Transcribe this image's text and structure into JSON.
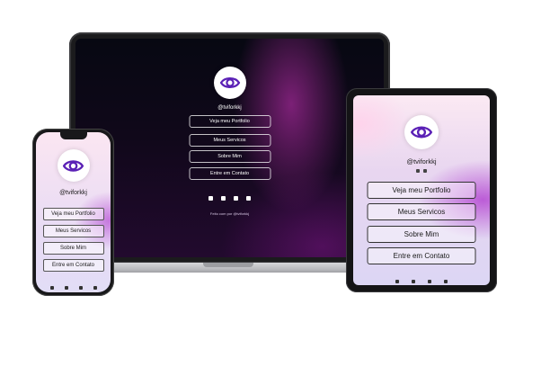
{
  "profile": {
    "handle": "@tviforkkj",
    "avatar_icon": "eye-icon",
    "accent_color": "#5b21b6"
  },
  "links": [
    {
      "label": "Veja meu Portfolio"
    },
    {
      "label": "Meus Servicos"
    },
    {
      "label": "Sobre Mim"
    },
    {
      "label": "Entre em Contato"
    }
  ],
  "social_icons": [
    "instagram-icon",
    "whatsapp-icon",
    "tiktok-icon",
    "linkedin-icon"
  ],
  "footer": {
    "text": "Feito com por @tviforkkj"
  }
}
